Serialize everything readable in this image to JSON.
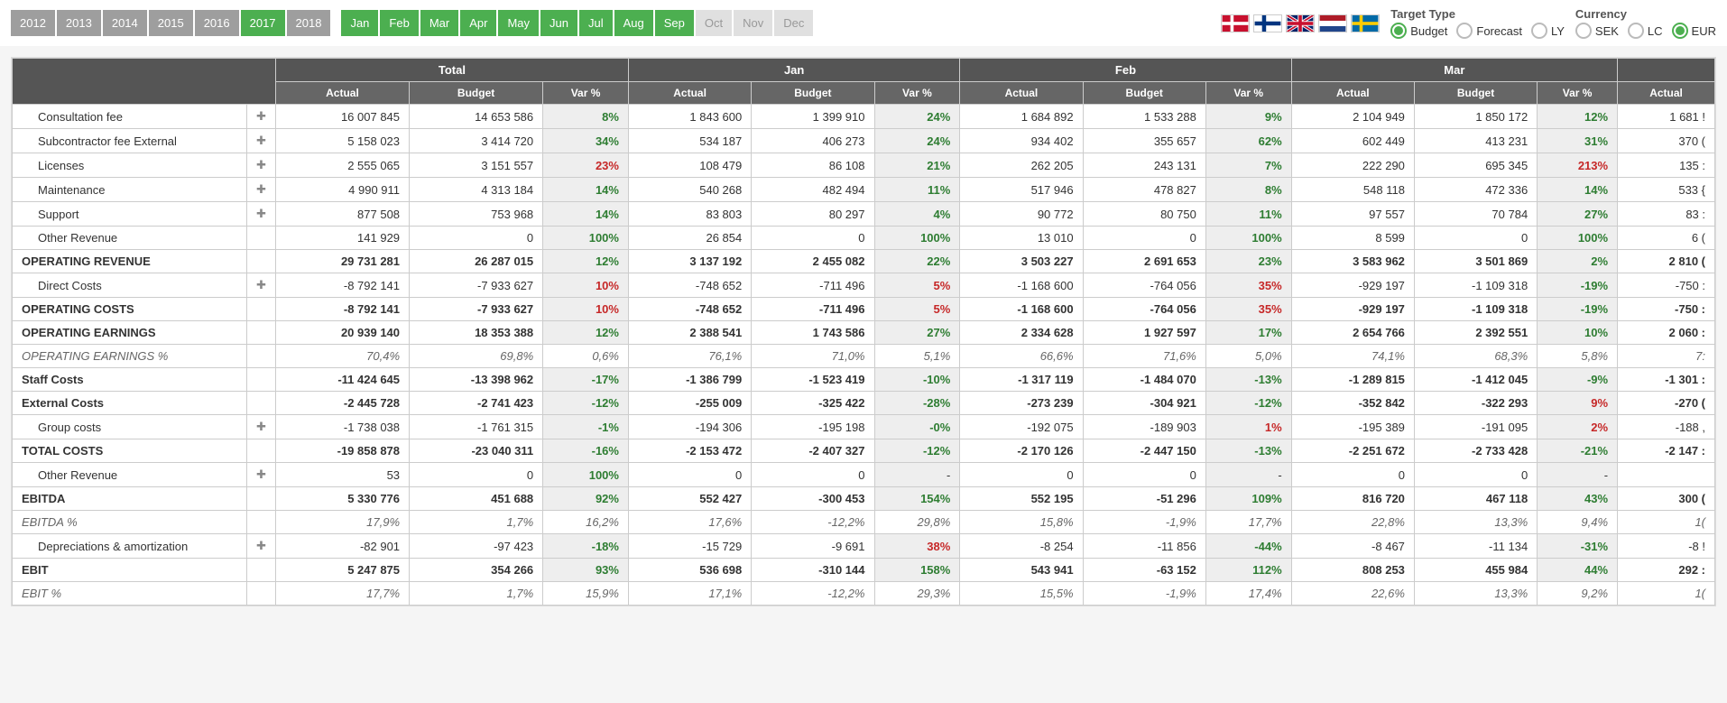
{
  "toolbar": {
    "years": [
      "2012",
      "2013",
      "2014",
      "2015",
      "2016",
      "2017",
      "2018"
    ],
    "active_year": "2017",
    "months": [
      "Jan",
      "Feb",
      "Mar",
      "Apr",
      "May",
      "Jun",
      "Jul",
      "Aug",
      "Sep",
      "Oct",
      "Nov",
      "Dec"
    ],
    "active_months": [
      "Jan",
      "Feb",
      "Mar",
      "Apr",
      "May",
      "Jun",
      "Jul",
      "Aug",
      "Sep"
    ],
    "flags": [
      "denmark",
      "finland",
      "uk",
      "netherlands",
      "sweden"
    ],
    "target_type": {
      "title": "Target Type",
      "options": [
        "Budget",
        "Forecast",
        "LY"
      ],
      "selected": "Budget"
    },
    "currency": {
      "title": "Currency",
      "options": [
        "SEK",
        "LC",
        "EUR"
      ],
      "selected": "EUR"
    }
  },
  "table": {
    "periods": [
      "Total",
      "Jan",
      "Feb",
      "Mar"
    ],
    "subcols": [
      "Actual",
      "Budget",
      "Var %"
    ],
    "extra_period": "",
    "extra_subcol": "Actual",
    "rows": [
      {
        "label": "Consultation fee",
        "expand": true,
        "indent": true,
        "cells": [
          "16 007 845",
          "14 653 586",
          "+8%",
          "1 843 600",
          "1 399 910",
          "+24%",
          "1 684 892",
          "1 533 288",
          "+9%",
          "2 104 949",
          "1 850 172",
          "+12%",
          "1 681 !"
        ]
      },
      {
        "label": "Subcontractor fee External",
        "expand": true,
        "indent": true,
        "cells": [
          "5 158 023",
          "3 414 720",
          "+34%",
          "534 187",
          "406 273",
          "+24%",
          "934 402",
          "355 657",
          "+62%",
          "602 449",
          "413 231",
          "+31%",
          "370 ("
        ]
      },
      {
        "label": "Licenses",
        "expand": true,
        "indent": true,
        "cells": [
          "2 555 065",
          "3 151 557",
          "-23%",
          "108 479",
          "86 108",
          "+21%",
          "262 205",
          "243 131",
          "+7%",
          "222 290",
          "695 345",
          "-213%",
          "135 :"
        ]
      },
      {
        "label": "Maintenance",
        "expand": true,
        "indent": true,
        "cells": [
          "4 990 911",
          "4 313 184",
          "+14%",
          "540 268",
          "482 494",
          "+11%",
          "517 946",
          "478 827",
          "+8%",
          "548 118",
          "472 336",
          "+14%",
          "533 {"
        ]
      },
      {
        "label": "Support",
        "expand": true,
        "indent": true,
        "cells": [
          "877 508",
          "753 968",
          "+14%",
          "83 803",
          "80 297",
          "+4%",
          "90 772",
          "80 750",
          "+11%",
          "97 557",
          "70 784",
          "+27%",
          "83 :"
        ]
      },
      {
        "label": "Other Revenue",
        "expand": false,
        "indent": true,
        "cells": [
          "141 929",
          "0",
          "+100%",
          "26 854",
          "0",
          "+100%",
          "13 010",
          "0",
          "+100%",
          "8 599",
          "0",
          "+100%",
          "6 ("
        ]
      },
      {
        "label": "OPERATING REVENUE",
        "cls": "bold",
        "cells": [
          "29 731 281",
          "26 287 015",
          "+12%",
          "3 137 192",
          "2 455 082",
          "+22%",
          "3 503 227",
          "2 691 653",
          "+23%",
          "3 583 962",
          "3 501 869",
          "+2%",
          "2 810 ("
        ]
      },
      {
        "label": "Direct Costs",
        "expand": true,
        "indent": true,
        "cells": [
          "-8 792 141",
          "-7 933 627",
          "-10%",
          "-748 652",
          "-711 496",
          "-5%",
          "-1 168 600",
          "-764 056",
          "-35%",
          "-929 197",
          "-1 109 318",
          "+-19%",
          "-750 :"
        ]
      },
      {
        "label": "OPERATING COSTS",
        "cls": "bold",
        "cells": [
          "-8 792 141",
          "-7 933 627",
          "-10%",
          "-748 652",
          "-711 496",
          "-5%",
          "-1 168 600",
          "-764 056",
          "-35%",
          "-929 197",
          "-1 109 318",
          "+-19%",
          "-750 :"
        ]
      },
      {
        "label": "OPERATING EARNINGS",
        "cls": "bold",
        "cells": [
          "20 939 140",
          "18 353 388",
          "+12%",
          "2 388 541",
          "1 743 586",
          "+27%",
          "2 334 628",
          "1 927 597",
          "+17%",
          "2 654 766",
          "2 392 551",
          "+10%",
          "2 060 :"
        ]
      },
      {
        "label": "OPERATING EARNINGS %",
        "cls": "italic",
        "cells": [
          "70,4%",
          "69,8%",
          "+0,6%",
          "76,1%",
          "71,0%",
          "+5,1%",
          "66,6%",
          "71,6%",
          "-5,0%",
          "74,1%",
          "68,3%",
          "+5,8%",
          "7:"
        ]
      },
      {
        "label": "Staff Costs",
        "cls": "bold",
        "cells": [
          "-11 424 645",
          "-13 398 962",
          "+-17%",
          "-1 386 799",
          "-1 523 419",
          "+-10%",
          "-1 317 119",
          "-1 484 070",
          "+-13%",
          "-1 289 815",
          "-1 412 045",
          "+-9%",
          "-1 301 :"
        ]
      },
      {
        "label": "External Costs",
        "cls": "bold",
        "cells": [
          "-2 445 728",
          "-2 741 423",
          "+-12%",
          "-255 009",
          "-325 422",
          "+-28%",
          "-273 239",
          "-304 921",
          "+-12%",
          "-352 842",
          "-322 293",
          "-9%",
          "-270 ("
        ]
      },
      {
        "label": "Group costs",
        "expand": true,
        "indent": true,
        "cells": [
          "-1 738 038",
          "-1 761 315",
          "+-1%",
          "-194 306",
          "-195 198",
          "+-0%",
          "-192 075",
          "-189 903",
          "-1%",
          "-195 389",
          "-191 095",
          "-2%",
          "-188 ,"
        ]
      },
      {
        "label": "TOTAL COSTS",
        "cls": "bold",
        "cells": [
          "-19 858 878",
          "-23 040 311",
          "+-16%",
          "-2 153 472",
          "-2 407 327",
          "+-12%",
          "-2 170 126",
          "-2 447 150",
          "+-13%",
          "-2 251 672",
          "-2 733 428",
          "+-21%",
          "-2 147 :"
        ]
      },
      {
        "label": "Other Revenue",
        "expand": true,
        "indent": true,
        "cells": [
          "53",
          "0",
          "+100%",
          "0",
          "0",
          "-",
          "0",
          "0",
          "-",
          "0",
          "0",
          "-",
          ""
        ]
      },
      {
        "label": "EBITDA",
        "cls": "bold",
        "cells": [
          "5 330 776",
          "451 688",
          "+92%",
          "552 427",
          "-300 453",
          "+154%",
          "552 195",
          "-51 296",
          "+109%",
          "816 720",
          "467 118",
          "+43%",
          "300 ("
        ]
      },
      {
        "label": "EBITDA %",
        "cls": "italic",
        "cells": [
          "17,9%",
          "1,7%",
          "+16,2%",
          "17,6%",
          "-12,2%",
          "+29,8%",
          "15,8%",
          "-1,9%",
          "+17,7%",
          "22,8%",
          "13,3%",
          "+9,4%",
          "1("
        ]
      },
      {
        "label": "Depreciations & amortization",
        "expand": true,
        "indent": true,
        "cells": [
          "-82 901",
          "-97 423",
          "+-18%",
          "-15 729",
          "-9 691",
          "-38%",
          "-8 254",
          "-11 856",
          "+-44%",
          "-8 467",
          "-11 134",
          "+-31%",
          "-8 !"
        ]
      },
      {
        "label": "EBIT",
        "cls": "bold",
        "cells": [
          "5 247 875",
          "354 266",
          "+93%",
          "536 698",
          "-310 144",
          "+158%",
          "543 941",
          "-63 152",
          "+112%",
          "808 253",
          "455 984",
          "+44%",
          "292 :"
        ]
      },
      {
        "label": "EBIT %",
        "cls": "italic",
        "cells": [
          "17,7%",
          "1,7%",
          "+15,9%",
          "17,1%",
          "-12,2%",
          "+29,3%",
          "15,5%",
          "-1,9%",
          "+17,4%",
          "22,6%",
          "13,3%",
          "+9,2%",
          "1("
        ]
      }
    ]
  }
}
